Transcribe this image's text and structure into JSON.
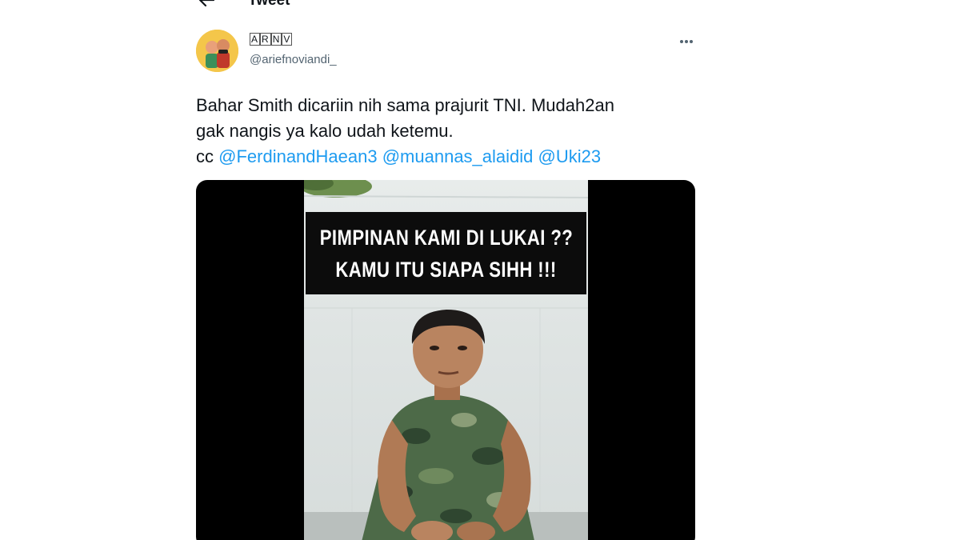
{
  "header": {
    "title": "Tweet",
    "back_icon": "arrow-left-icon"
  },
  "tweet": {
    "author": {
      "display_name_chars": [
        "A",
        "R",
        "N",
        "V"
      ],
      "handle": "@ariefnoviandi_"
    },
    "more_icon": "more-horizontal-icon",
    "text_line1": "Bahar Smith dicariin nih sama prajurit TNI. Mudah2an",
    "text_line2": "gak nangis ya kalo udah ketemu.",
    "cc_label": "cc",
    "mentions": [
      "@FerdinandHaean3",
      "@muannas_alaidid",
      "@Uki23"
    ],
    "media": {
      "caption_line1": "PIMPINAN KAMI DI LUKAI ??",
      "caption_line2": "KAMU ITU SIAPA SIHH !!!"
    }
  },
  "colors": {
    "link": "#1d9bf0",
    "text": "#0f1419",
    "secondary": "#536471"
  }
}
